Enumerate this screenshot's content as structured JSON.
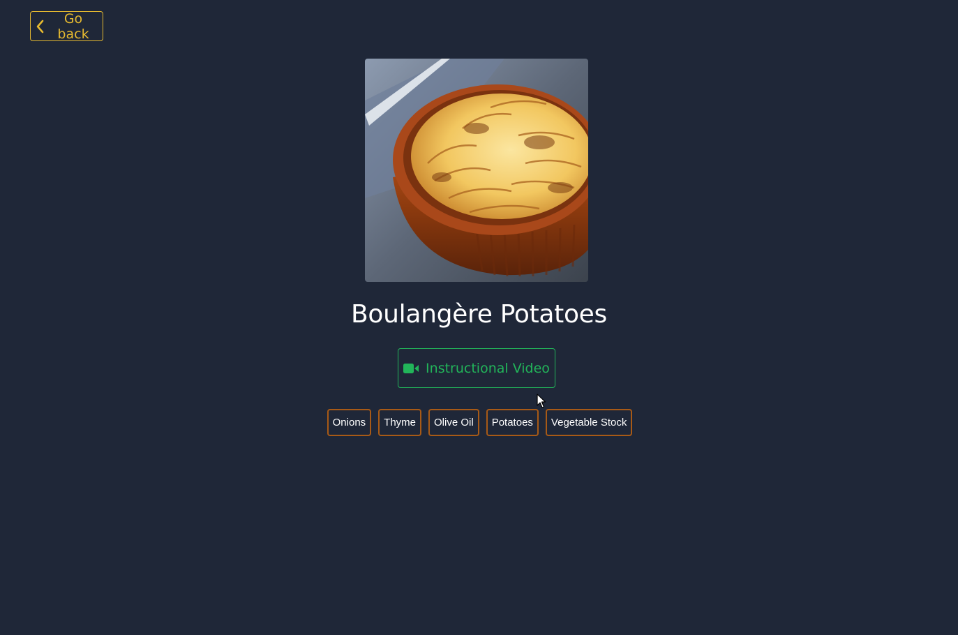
{
  "nav": {
    "back_label": "Go back",
    "back_icon": "chevron-left-icon"
  },
  "recipe": {
    "image_alt": "Boulangère Potatoes",
    "title": "Boulangère Potatoes",
    "video_label": "Instructional Video",
    "video_icon": "video-camera-icon",
    "ingredients": [
      "Onions",
      "Thyme",
      "Olive Oil",
      "Potatoes",
      "Vegetable Stock"
    ]
  },
  "colors": {
    "background": "#1f2738",
    "back_accent": "#e5b930",
    "video_accent": "#22b55a",
    "tag_border": "#a85a16",
    "title_text": "#ffffff"
  }
}
